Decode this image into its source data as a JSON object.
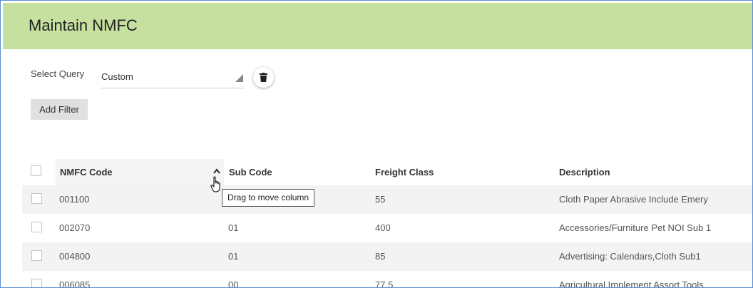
{
  "header": {
    "title": "Maintain NMFC",
    "bg_color": "#c6e0a0"
  },
  "query": {
    "label": "Select Query",
    "selected": "Custom",
    "delete_icon": "trash-icon"
  },
  "add_filter_label": "Add Filter",
  "table": {
    "columns": [
      "NMFC Code",
      "Sub Code",
      "Freight Class",
      "Description"
    ],
    "sort": {
      "column": "NMFC Code",
      "direction": "ascending"
    },
    "rows": [
      {
        "code": "001100",
        "sub": "",
        "class": "55",
        "desc": "Cloth Paper Abrasive Include Emery"
      },
      {
        "code": "002070",
        "sub": "01",
        "class": "400",
        "desc": "Accessories/Furniture Pet NOI Sub 1"
      },
      {
        "code": "004800",
        "sub": "01",
        "class": "85",
        "desc": "Advertising: Calendars,Cloth Sub1"
      },
      {
        "code": "006085",
        "sub": "00",
        "class": "77.5",
        "desc": "Agricultural Implement Assort Tools"
      }
    ]
  },
  "tooltip": "Drag to move column"
}
